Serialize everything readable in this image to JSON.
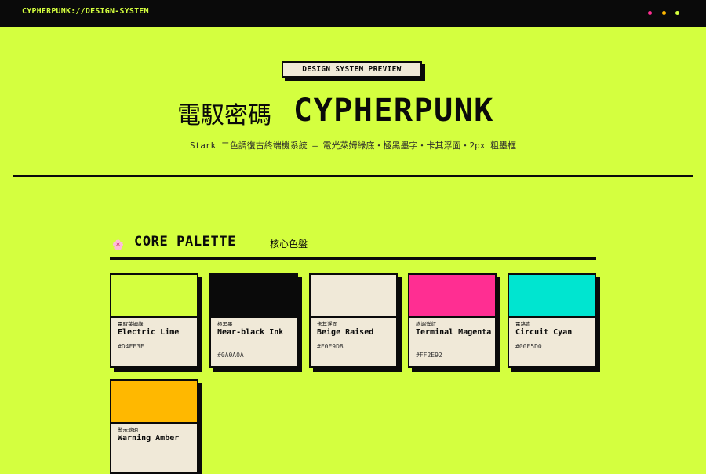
{
  "header": {
    "brand": "CYPHERPUNK://DESIGN-SYSTEM",
    "dots": [
      {
        "name": "status-dot-pink",
        "color": "#FF2E92"
      },
      {
        "name": "status-dot-amber",
        "color": "#FFB800"
      },
      {
        "name": "status-dot-lime",
        "color": "#D4FF3F"
      }
    ]
  },
  "hero": {
    "badge": "DESIGN SYSTEM PREVIEW",
    "title_cjk": "電馭密碼",
    "title": "CYPHERPUNK",
    "subtitle": "Stark 二色調復古終端機系統 — 電光萊姆綠底・極黑墨字・卡其浮面・2px 粗墨框"
  },
  "core_palette": {
    "icon": "flower-icon",
    "title": "CORE PALETTE",
    "title_cjk": "核心色盤",
    "swatches": [
      {
        "cjk": "電馭萊姆綠",
        "name": "Electric Lime",
        "hex": "#D4FF3F",
        "color": "#D4FF3F"
      },
      {
        "cjk": "極黑墨",
        "name": "Near-black Ink",
        "hex": "#0A0A0A",
        "color": "#0A0A0A"
      },
      {
        "cjk": "卡其浮面",
        "name": "Beige Raised",
        "hex": "#F0E9D8",
        "color": "#F0E9D8"
      },
      {
        "cjk": "終端洋紅",
        "name": "Terminal Magenta",
        "hex": "#FF2E92",
        "color": "#FF2E92"
      },
      {
        "cjk": "電路青",
        "name": "Circuit Cyan",
        "hex": "#00E5D0",
        "color": "#00E5D0"
      },
      {
        "cjk": "警示琥珀",
        "name": "Warning Amber",
        "hex": "",
        "color": "#FFB800"
      }
    ]
  }
}
